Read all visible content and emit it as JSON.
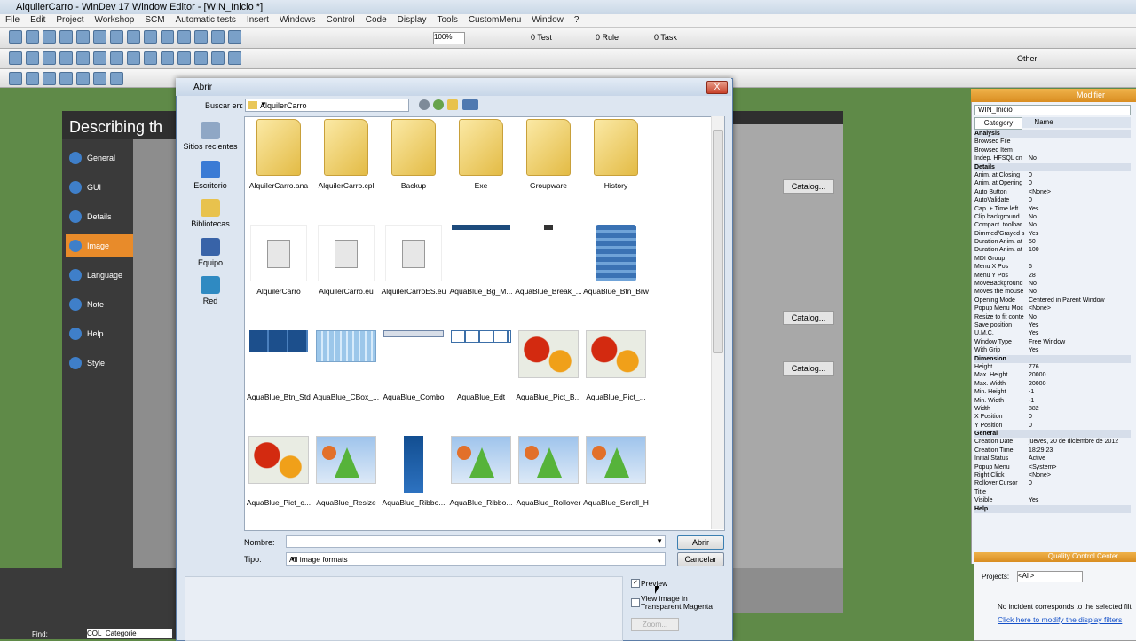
{
  "window_title": "AlquilerCarro - WinDev 17  Window Editor - [WIN_Inicio *]",
  "menu": [
    "File",
    "Edit",
    "Project",
    "Workshop",
    "SCM",
    "Automatic tests",
    "Insert",
    "Windows",
    "Control",
    "Code",
    "Display",
    "Tools",
    "CustomMenu",
    "Window",
    "?"
  ],
  "toolbar": {
    "zoom": "100%",
    "test_count": "0 Test",
    "rule_count": "0 Rule",
    "task_count": "0 Task",
    "other_label": "Other"
  },
  "editor": {
    "description_title": "Describing th",
    "nav_items": [
      "General",
      "GUI",
      "Details",
      "Image",
      "Language",
      "Note",
      "Help",
      "Style"
    ],
    "active_nav": "Image",
    "catalog_label": "Catalog..."
  },
  "modifier": {
    "header": "Modifier",
    "window_name": "WIN_Inicio",
    "tabs": [
      "Category",
      "Name"
    ],
    "rows": [
      {
        "k": "Analysis",
        "v": "",
        "sec": true
      },
      {
        "k": "Browsed File",
        "v": ""
      },
      {
        "k": "Browsed Item",
        "v": ""
      },
      {
        "k": "Indep. HFSQL cn",
        "v": "No"
      },
      {
        "k": "Details",
        "v": "",
        "sec": true
      },
      {
        "k": "Anim. at Closing",
        "v": "0"
      },
      {
        "k": "Anim. at Opening",
        "v": "0"
      },
      {
        "k": "Auto Button",
        "v": "<None>"
      },
      {
        "k": "AutoValidate",
        "v": "0"
      },
      {
        "k": "Cap. + Time left",
        "v": "Yes"
      },
      {
        "k": "Clip background",
        "v": "No"
      },
      {
        "k": "Compact. toolbar",
        "v": "No"
      },
      {
        "k": "Dimmed/Grayed s",
        "v": "Yes"
      },
      {
        "k": "Duration Anim. at",
        "v": "50"
      },
      {
        "k": "Duration Anim. at",
        "v": "100"
      },
      {
        "k": "MDI Group",
        "v": ""
      },
      {
        "k": "Menu X Pos",
        "v": "6"
      },
      {
        "k": "Menu Y Pos",
        "v": "28"
      },
      {
        "k": "MoveBackground",
        "v": "No"
      },
      {
        "k": "Moves the mouse",
        "v": "No"
      },
      {
        "k": "Opening Mode",
        "v": "Centered in Parent Window"
      },
      {
        "k": "Popup Menu Moc",
        "v": "<None>"
      },
      {
        "k": "Resize to fit conte",
        "v": "No"
      },
      {
        "k": "Save position",
        "v": "Yes"
      },
      {
        "k": "U.M.C.",
        "v": "Yes"
      },
      {
        "k": "Window Type",
        "v": "Free Window"
      },
      {
        "k": "With Grip",
        "v": "Yes"
      },
      {
        "k": "Dimension",
        "v": "",
        "sec": true
      },
      {
        "k": "Height",
        "v": "776"
      },
      {
        "k": "Max. Height",
        "v": "20000"
      },
      {
        "k": "Max. Width",
        "v": "20000"
      },
      {
        "k": "Min. Height",
        "v": "-1"
      },
      {
        "k": "Min. Width",
        "v": "-1"
      },
      {
        "k": "Width",
        "v": "882"
      },
      {
        "k": "X Position",
        "v": "0"
      },
      {
        "k": "Y Position",
        "v": "0"
      },
      {
        "k": "General",
        "v": "",
        "sec": true
      },
      {
        "k": "Creation Date",
        "v": "jueves, 20 de diciembre de 2012"
      },
      {
        "k": "Creation Time",
        "v": "18:29:23"
      },
      {
        "k": "Initial Status",
        "v": "Active"
      },
      {
        "k": "Popup Menu",
        "v": "<System>"
      },
      {
        "k": "Right Click",
        "v": "<None>"
      },
      {
        "k": "Rollover Cursor",
        "v": "0"
      },
      {
        "k": "Title",
        "v": ""
      },
      {
        "k": "Visible",
        "v": "Yes"
      },
      {
        "k": "Help",
        "v": "",
        "sec": true
      }
    ]
  },
  "quality_center": {
    "header": "Quality Control Center",
    "projects_label": "Projects:",
    "projects_value": "<All>",
    "message": "No incident corresponds to the selected filt",
    "link": "Click here to modify the display filters"
  },
  "bottom": {
    "find_label": "Find:",
    "find_value": "COL_Categorie"
  },
  "dialog": {
    "title": "Abrir",
    "close": "X",
    "look_in_label": "Buscar en:",
    "look_in_value": "AlquilerCarro",
    "places": [
      "Sitios recientes",
      "Escritorio",
      "Bibliotecas",
      "Equipo",
      "Red"
    ],
    "files": [
      {
        "name": "AlquilerCarro.ana",
        "kind": "folder"
      },
      {
        "name": "AlquilerCarro.cpl",
        "kind": "folder"
      },
      {
        "name": "Backup",
        "kind": "folder"
      },
      {
        "name": "Exe",
        "kind": "folder"
      },
      {
        "name": "Groupware",
        "kind": "folder"
      },
      {
        "name": "History",
        "kind": "folder"
      },
      {
        "name": "AlquilerCarro",
        "kind": "doc"
      },
      {
        "name": "AlquilerCarro.eu",
        "kind": "doc"
      },
      {
        "name": "AlquilerCarroES.eu",
        "kind": "doc"
      },
      {
        "name": "AquaBlue_Bg_M...",
        "kind": "strip"
      },
      {
        "name": "AquaBlue_Break_...",
        "kind": "break"
      },
      {
        "name": "AquaBlue_Btn_Brw",
        "kind": "brw"
      },
      {
        "name": "AquaBlue_Btn_Std",
        "kind": "btnstd"
      },
      {
        "name": "AquaBlue_CBox_...",
        "kind": "cbox"
      },
      {
        "name": "AquaBlue_Combo",
        "kind": "combo"
      },
      {
        "name": "AquaBlue_Edt",
        "kind": "edt"
      },
      {
        "name": "AquaBlue_Pict_B...",
        "kind": "flower"
      },
      {
        "name": "AquaBlue_Pict_...",
        "kind": "flower"
      },
      {
        "name": "AquaBlue_Pict_o...",
        "kind": "flower"
      },
      {
        "name": "AquaBlue_Resize",
        "kind": "cone"
      },
      {
        "name": "AquaBlue_Ribbo...",
        "kind": "ribbon"
      },
      {
        "name": "AquaBlue_Ribbo...",
        "kind": "cone"
      },
      {
        "name": "AquaBlue_Rollover",
        "kind": "cone"
      },
      {
        "name": "AquaBlue_Scroll_H",
        "kind": "cone"
      }
    ],
    "name_label": "Nombre:",
    "name_value": "",
    "type_label": "Tipo:",
    "type_value": "All image formats",
    "open_button": "Abrir",
    "cancel_button": "Cancelar",
    "preview_label": "Preview",
    "preview_checked": true,
    "transparent_label": "View image in Transparent Magenta",
    "zoom_button": "Zoom..."
  }
}
